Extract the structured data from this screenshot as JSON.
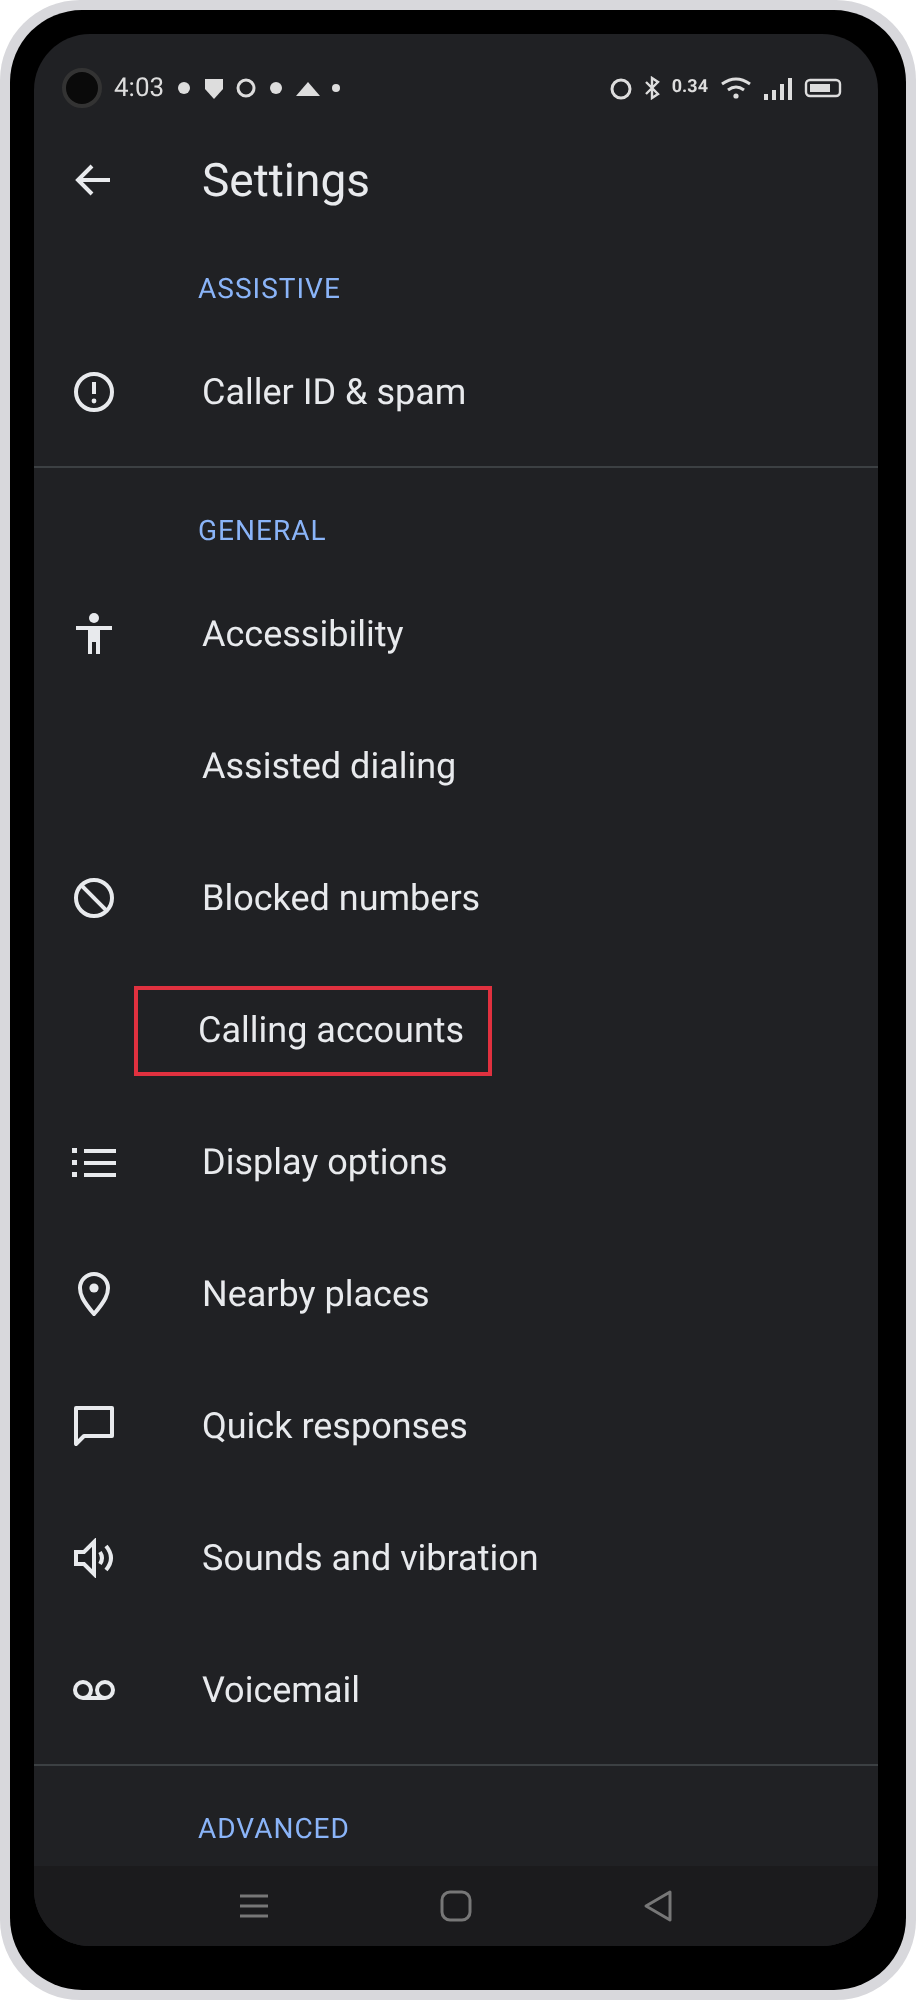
{
  "status_bar": {
    "time": "4:03",
    "speed": "0.34"
  },
  "header": {
    "title": "Settings"
  },
  "sections": [
    {
      "title": "ASSISTIVE",
      "items": [
        {
          "label": "Caller ID & spam",
          "kind": "alert",
          "highlighted": false
        }
      ]
    },
    {
      "title": "GENERAL",
      "items": [
        {
          "label": "Accessibility",
          "kind": "person",
          "highlighted": false
        },
        {
          "label": "Assisted dialing",
          "kind": "plain",
          "highlighted": false
        },
        {
          "label": "Blocked numbers",
          "kind": "block",
          "highlighted": false
        },
        {
          "label": "Calling accounts",
          "kind": "plain",
          "highlighted": true
        },
        {
          "label": "Display options",
          "kind": "list",
          "highlighted": false
        },
        {
          "label": "Nearby places",
          "kind": "pin",
          "highlighted": false
        },
        {
          "label": "Quick responses",
          "kind": "bubble",
          "highlighted": false
        },
        {
          "label": "Sounds and vibration",
          "kind": "speaker",
          "highlighted": false
        },
        {
          "label": "Voicemail",
          "kind": "tape",
          "highlighted": false
        }
      ]
    },
    {
      "title": "ADVANCED"
    }
  ]
}
